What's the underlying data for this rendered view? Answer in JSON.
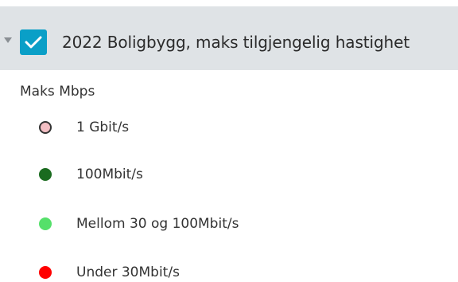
{
  "layer": {
    "title": "2022 Boligbygg, maks tilgjengelig hastighet",
    "checked": true
  },
  "legend": {
    "heading": "Maks Mbps",
    "items": [
      {
        "label": "1 Gbit/s",
        "fill": "#f4bfc4",
        "stroke": "#333333"
      },
      {
        "label": "100Mbit/s",
        "fill": "#1a6b1f",
        "stroke": "#1a6b1f"
      },
      {
        "label": "Mellom 30 og 100Mbit/s",
        "fill": "#55e06a",
        "stroke": "#55e06a"
      },
      {
        "label": "Under 30Mbit/s",
        "fill": "#ff0000",
        "stroke": "#ff0000"
      }
    ]
  },
  "colors": {
    "header_background": "#dfe3e6",
    "checkbox": "#0a9fc7"
  }
}
